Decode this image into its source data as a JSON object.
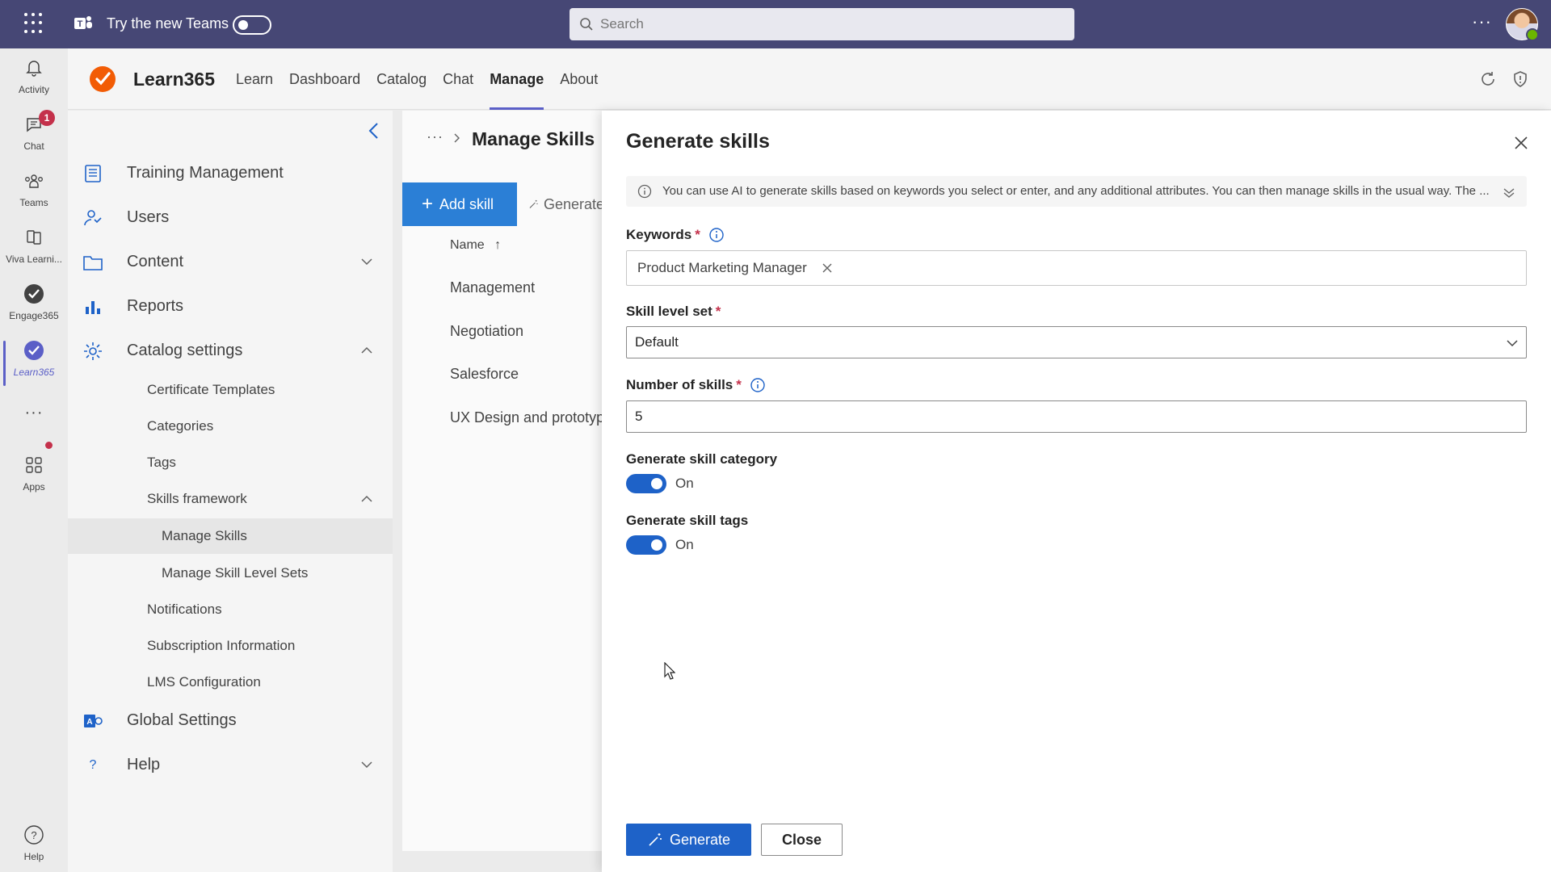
{
  "topbar": {
    "try_new_teams": "Try the new Teams",
    "search_placeholder": "Search",
    "more": "···"
  },
  "rail": {
    "items": [
      {
        "label": "Activity",
        "icon": "bell-icon"
      },
      {
        "label": "Chat",
        "icon": "chat-icon",
        "badge": "1"
      },
      {
        "label": "Teams",
        "icon": "teams-icon"
      },
      {
        "label": "Viva Learni...",
        "icon": "book-icon"
      },
      {
        "label": "Engage365",
        "icon": "engage-icon"
      },
      {
        "label": "Learn365",
        "icon": "learn-icon",
        "active": true
      },
      {
        "label": "Apps",
        "icon": "apps-icon"
      },
      {
        "label": "Help",
        "icon": "help-icon"
      }
    ],
    "more": "···"
  },
  "app": {
    "name": "Learn365",
    "tabs": [
      "Learn",
      "Dashboard",
      "Catalog",
      "Chat",
      "Manage",
      "About"
    ],
    "active_tab": "Manage"
  },
  "leftnav": {
    "items": {
      "training": "Training Management",
      "users": "Users",
      "content": "Content",
      "reports": "Reports",
      "catalog": "Catalog settings",
      "global": "Global Settings",
      "help": "Help",
      "help_icon": "?"
    },
    "catalog_sub": {
      "certificate": "Certificate Templates",
      "categories": "Categories",
      "tags": "Tags",
      "skills": "Skills framework",
      "notifications": "Notifications",
      "subscription": "Subscription Information",
      "lms": "LMS Configuration"
    },
    "skills_sub": {
      "manage_skills": "Manage Skills",
      "manage_levels": "Manage Skill Level Sets"
    }
  },
  "content": {
    "breadcrumb_more": "···",
    "title": "Manage Skills",
    "add_skill": "Add skill",
    "generate_partial": "Generate",
    "column_name": "Name",
    "rows": [
      "Management",
      "Negotiation",
      "Salesforce",
      "UX Design and prototyping"
    ]
  },
  "panel": {
    "title": "Generate skills",
    "info": "You can use AI to generate skills based on keywords you select or enter, and any additional attributes. You can then manage skills in the usual way. The ...",
    "keywords_label": "Keywords",
    "keyword_chip": "Product Marketing Manager",
    "skill_level_label": "Skill level set",
    "skill_level_value": "Default",
    "num_skills_label": "Number of skills",
    "num_skills_value": "5",
    "gen_category_label": "Generate skill category",
    "gen_category_state": "On",
    "gen_tags_label": "Generate skill tags",
    "gen_tags_state": "On",
    "required_mark": "*",
    "generate_button": "Generate",
    "close_button": "Close"
  },
  "colors": {
    "teams_purple": "#464775",
    "accent_blue": "#1e62c8",
    "add_blue": "#2b7fd6",
    "brand_orange": "#f25c05",
    "badge_red": "#c4314b"
  }
}
